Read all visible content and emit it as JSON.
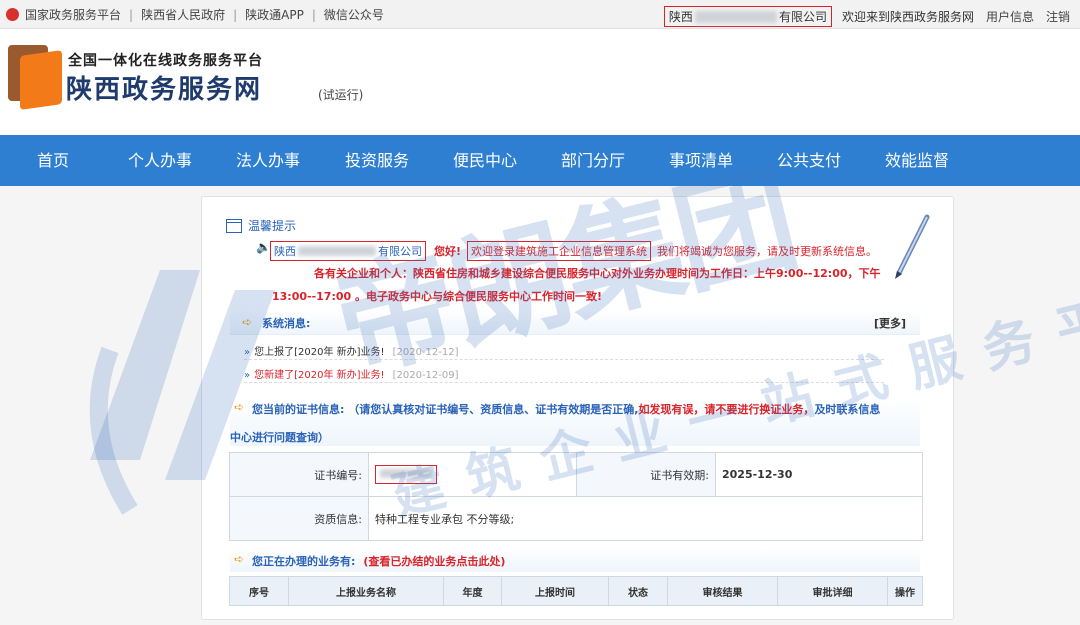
{
  "topbar": {
    "links": [
      "国家政务服务平台",
      "陕西省人民政府",
      "陕政通APP",
      "微信公众号"
    ],
    "company_prefix": "陕西",
    "company_suffix": "有限公司",
    "welcome": "欢迎来到陕西政务服务网",
    "user_info": "用户信息",
    "logout": "注销"
  },
  "header": {
    "slogan": "全国一体化在线政务服务平台",
    "site_title": "陕西政务服务网",
    "trial": "(试运行)"
  },
  "nav": {
    "items": [
      "首页",
      "个人办事",
      "法人办事",
      "投资服务",
      "便民中心",
      "部门分厅",
      "事项清单",
      "公共支付",
      "效能监督"
    ]
  },
  "notice": {
    "title": "温馨提示",
    "company_prefix": "陕西",
    "company_suffix": "有限公司",
    "greeting": "您好!",
    "welcome": "欢迎登录建筑施工企业信息管理系统",
    "service": "我们将竭诚为您服务，请及时更新系统信息。",
    "line2": "各有关企业和个人：陕西省住房和城乡建设综合便民服务中心对外业务办理时间为工作日：上午9:00--12:00，下午",
    "line3": "13:00--17:00 。电子政务中心与综合便民服务中心工作时间一致!"
  },
  "messages": {
    "title": "系统消息:",
    "more": "[更多]",
    "items": [
      {
        "text": "您上报了[2020年 新办]业务!",
        "date": "[2020-12-12]"
      },
      {
        "text": "您新建了[2020年 新办]业务!",
        "date": "[2020-12-09]"
      }
    ]
  },
  "cert": {
    "title_a": "您当前的证书信息:",
    "title_b": "（请您认真核对证书编号、资质信息、证书有效期是否正确,",
    "title_red": "如发现有误，请不要进行换证业务，",
    "title_c": "及时联系信息",
    "title_line2": "中心进行问题查询）",
    "no_label": "证书编号:",
    "expiry_label": "证书有效期:",
    "expiry_value": "2025-12-30",
    "qual_label": "资质信息:",
    "qual_value": "特种工程专业承包 不分等级;"
  },
  "business": {
    "title": "您正在办理的业务有:",
    "link": "(查看已办结的业务点击此处)",
    "columns": [
      "序号",
      "上报业务名称",
      "年度",
      "上报时间",
      "状态",
      "审核结果",
      "审批详细",
      "操作"
    ]
  },
  "watermark": {
    "main": "帝朗集团",
    "sub": "建筑企业一站式服务平台"
  },
  "colors": {
    "nav_blue": "#2e7fd1",
    "link_blue": "#2a62b8",
    "alert_red": "#d9232b"
  }
}
